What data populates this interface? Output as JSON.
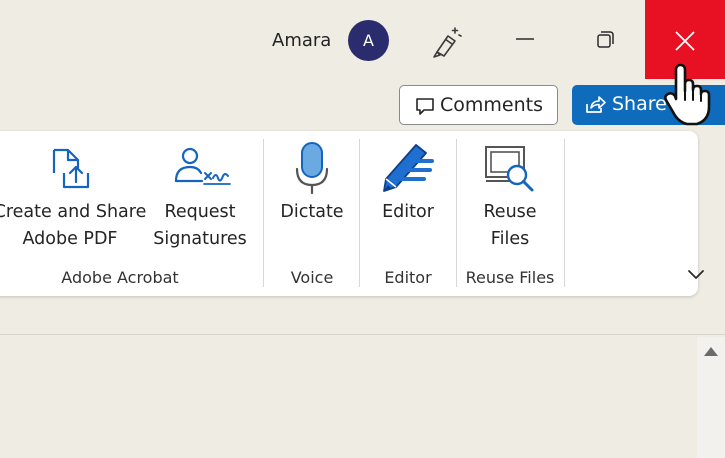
{
  "titlebar": {
    "user_name": "Amara",
    "avatar_initial": "A",
    "close_color": "#e81123"
  },
  "actions": {
    "comments_label": "Comments",
    "share_label": "Share",
    "share_color": "#0f6cbd"
  },
  "ribbon": {
    "groups": [
      {
        "name": "Adobe Acrobat",
        "items": [
          {
            "line1": "Create and Share",
            "line2": "Adobe PDF",
            "icon": "pdf-share-icon"
          },
          {
            "line1": "Request",
            "line2": "Signatures",
            "icon": "signature-icon"
          }
        ]
      },
      {
        "name": "Voice",
        "items": [
          {
            "line1": "Dictate",
            "icon": "microphone-icon"
          }
        ]
      },
      {
        "name": "Editor",
        "items": [
          {
            "line1": "Editor",
            "icon": "editor-pen-icon"
          }
        ]
      },
      {
        "name": "Reuse Files",
        "items": [
          {
            "line1": "Reuse",
            "line2": "Files",
            "icon": "reuse-files-icon"
          }
        ]
      }
    ]
  },
  "icons": {
    "pen": "pen-sparkle-icon",
    "minimize": "minimize-icon",
    "restore": "restore-icon",
    "close": "close-icon",
    "expand": "chevron-down-icon",
    "scroll_up": "scroll-up-arrow-icon"
  }
}
